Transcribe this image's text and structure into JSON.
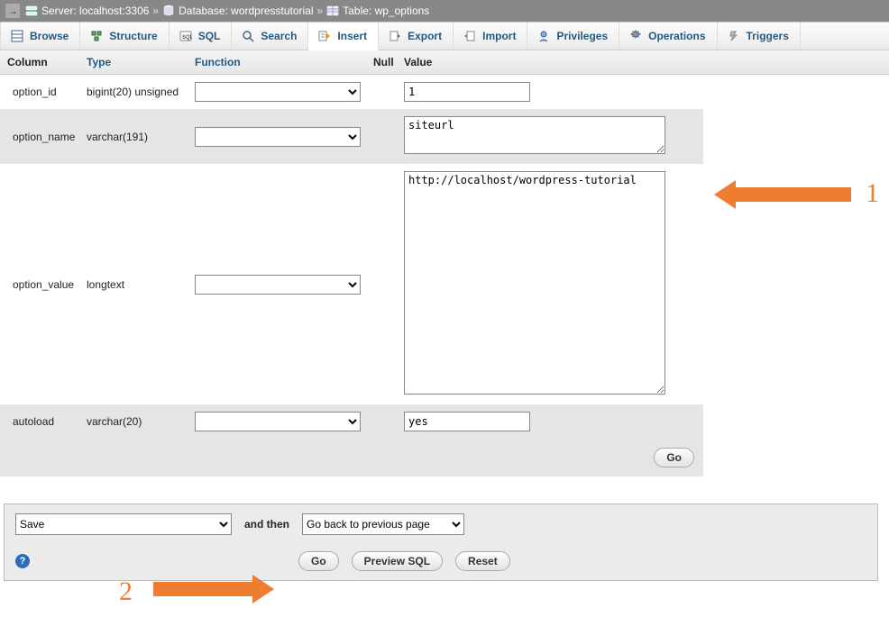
{
  "breadcrumb": {
    "server_label": "Server:",
    "server_value": "localhost:3306",
    "db_label": "Database:",
    "db_value": "wordpresstutorial",
    "table_label": "Table:",
    "table_value": "wp_options"
  },
  "tabs": {
    "browse": "Browse",
    "structure": "Structure",
    "sql": "SQL",
    "search": "Search",
    "insert": "Insert",
    "export": "Export",
    "import": "Import",
    "privileges": "Privileges",
    "operations": "Operations",
    "triggers": "Triggers"
  },
  "headers": {
    "column": "Column",
    "type": "Type",
    "function": "Function",
    "null": "Null",
    "value": "Value"
  },
  "rows": [
    {
      "column": "option_id",
      "type": "bigint(20) unsigned",
      "value": "1",
      "control": "input"
    },
    {
      "column": "option_name",
      "type": "varchar(191)",
      "value": "siteurl",
      "control": "textarea_small"
    },
    {
      "column": "option_value",
      "type": "longtext",
      "value": "http://localhost/wordpress-tutorial",
      "control": "textarea_big"
    },
    {
      "column": "autoload",
      "type": "varchar(20)",
      "value": "yes",
      "control": "input"
    }
  ],
  "buttons": {
    "go": "Go",
    "preview_sql": "Preview SQL",
    "reset": "Reset"
  },
  "bottom": {
    "save_select": "Save",
    "and_then": "and then",
    "and_then_select": "Go back to previous page"
  },
  "annotations": {
    "n1": "1",
    "n2": "2"
  }
}
